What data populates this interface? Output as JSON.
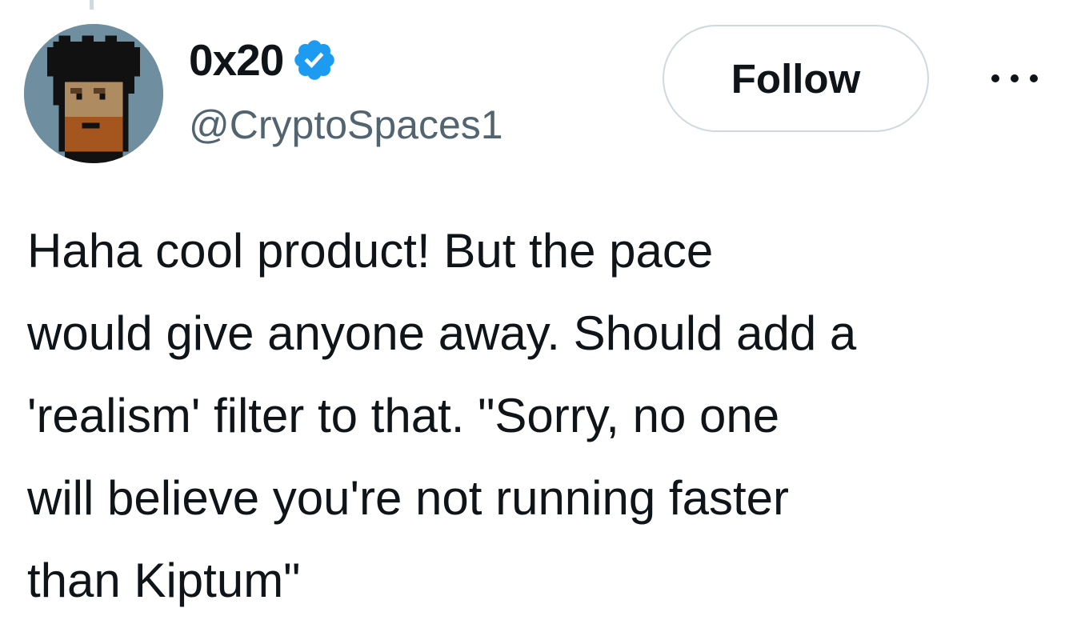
{
  "author": {
    "display_name": "0x20",
    "handle": "@CryptoSpaces1",
    "verified": true,
    "avatar_icon": "pixel-punk-avatar",
    "verified_icon": "verified-badge-icon"
  },
  "actions": {
    "follow_label": "Follow",
    "more_icon": "more-options-icon"
  },
  "tweet": {
    "lines": [
      "Haha cool product! But the pace",
      "would give anyone away. Should add a",
      "'realism' filter to that. \"Sorry, no one",
      "will believe you're not running faster",
      "than Kiptum\""
    ]
  },
  "colors": {
    "text_primary": "#0f1419",
    "text_secondary": "#536471",
    "verified_blue": "#1d9bf0",
    "border": "#cfd9de"
  }
}
